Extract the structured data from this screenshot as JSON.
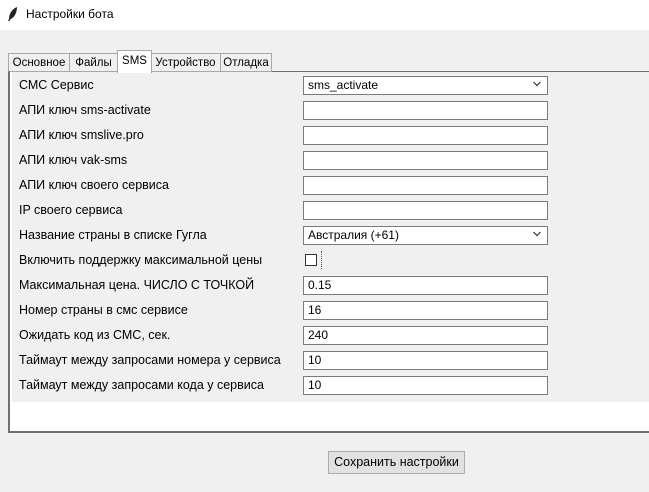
{
  "window": {
    "title": "Настройки бота",
    "icon": "feather-icon"
  },
  "tabs": [
    {
      "label": "Основное"
    },
    {
      "label": "Файлы"
    },
    {
      "label": "SMS",
      "active": true
    },
    {
      "label": "Устройство"
    },
    {
      "label": "Отладка"
    }
  ],
  "form": {
    "sms_service": {
      "label": "СМС Сервис",
      "value": "sms_activate"
    },
    "api_sms_activate": {
      "label": "АПИ ключ sms-activate",
      "value": ""
    },
    "api_smslive": {
      "label": "АПИ ключ smslive.pro",
      "value": ""
    },
    "api_vak_sms": {
      "label": "АПИ ключ vak-sms",
      "value": ""
    },
    "api_own": {
      "label": "АПИ ключ своего сервиса",
      "value": ""
    },
    "ip_own": {
      "label": "IP своего сервиса",
      "value": ""
    },
    "country_name": {
      "label": "Название страны в списке Гугла",
      "value": "Австралия (+61)"
    },
    "max_price_enabled": {
      "label": "Включить поддержку максимальной цены",
      "checked": false
    },
    "max_price": {
      "label": "Максимальная цена. ЧИСЛО С ТОЧКОЙ",
      "value": "0.15"
    },
    "country_number": {
      "label": "Номер страны в смс сервисе",
      "value": "16"
    },
    "wait_code": {
      "label": "Ожидать код из СМС, сек.",
      "value": "240"
    },
    "timeout_number": {
      "label": "Таймаут между запросами номера у сервиса",
      "value": "10"
    },
    "timeout_code": {
      "label": "Таймаут между запросами кода у сервиса",
      "value": "10"
    }
  },
  "save_button": {
    "label": "Сохранить настройки"
  }
}
